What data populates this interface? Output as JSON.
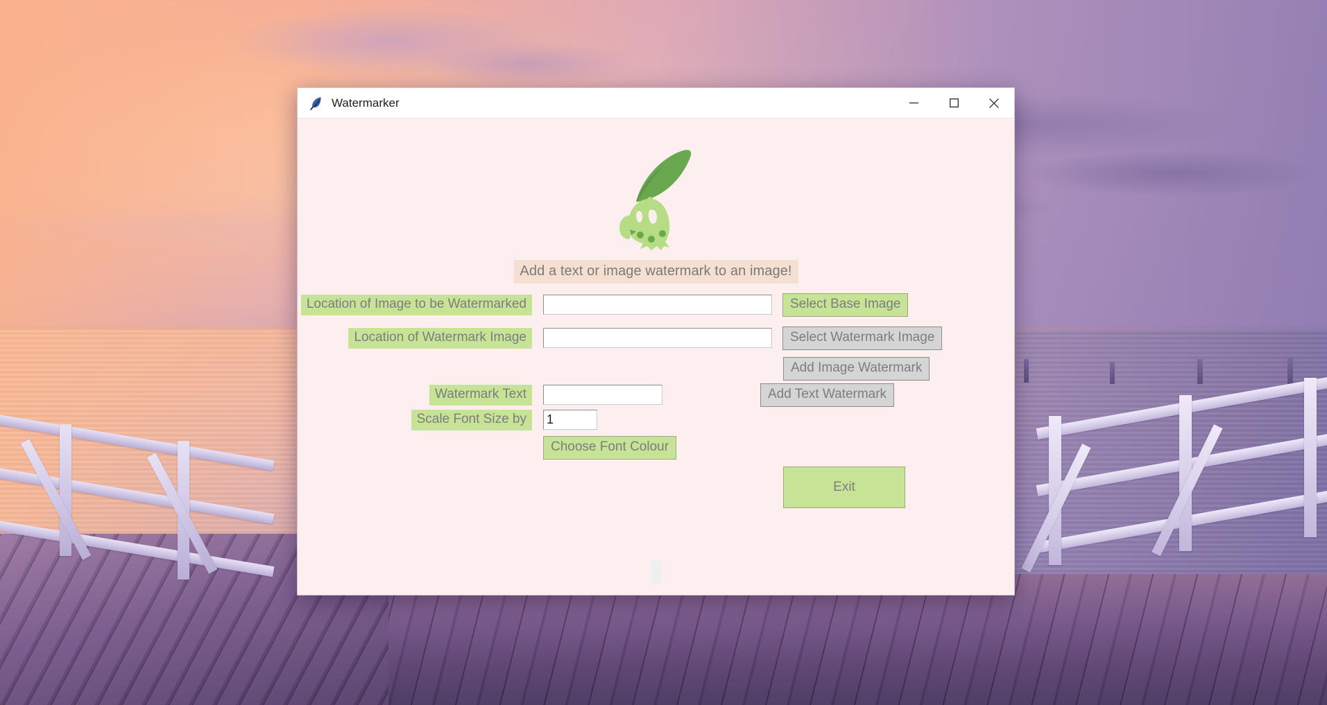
{
  "window": {
    "title": "Watermarker",
    "icon": "feather-quill-icon",
    "controls": {
      "minimize": "minimize-icon",
      "maximize": "maximize-icon",
      "close": "close-icon"
    }
  },
  "content": {
    "logo_alt": "chikorita-mascot-logo",
    "tagline": "Add a text or image watermark to an image!",
    "fields": {
      "base_image_label": "Location of Image to be Watermarked",
      "base_image_value": "",
      "base_image_placeholder": "",
      "watermark_image_label": "Location of Watermark Image",
      "watermark_image_value": "",
      "watermark_image_placeholder": "",
      "watermark_text_label": "Watermark Text",
      "watermark_text_value": "",
      "watermark_text_placeholder": "",
      "scale_font_label": "Scale Font Size by",
      "scale_font_value": "1"
    },
    "buttons": {
      "select_base_image": "Select Base Image",
      "select_watermark_image": "Select Watermark Image",
      "add_image_watermark": "Add Image Watermark",
      "add_text_watermark": "Add Text Watermark",
      "choose_font_colour": "Choose Font Colour",
      "exit": "Exit"
    }
  },
  "colors": {
    "window_background": "#fdeef0",
    "titlebar_background": "#ffffff",
    "label_green": "#c7e396",
    "tagline_background": "#f5dfd0",
    "button_grey": "#d5d5d5",
    "text_grey": "#7d7d7d",
    "leaf_dark_green": "#6aa84f",
    "body_light_green": "#b6dc84"
  }
}
